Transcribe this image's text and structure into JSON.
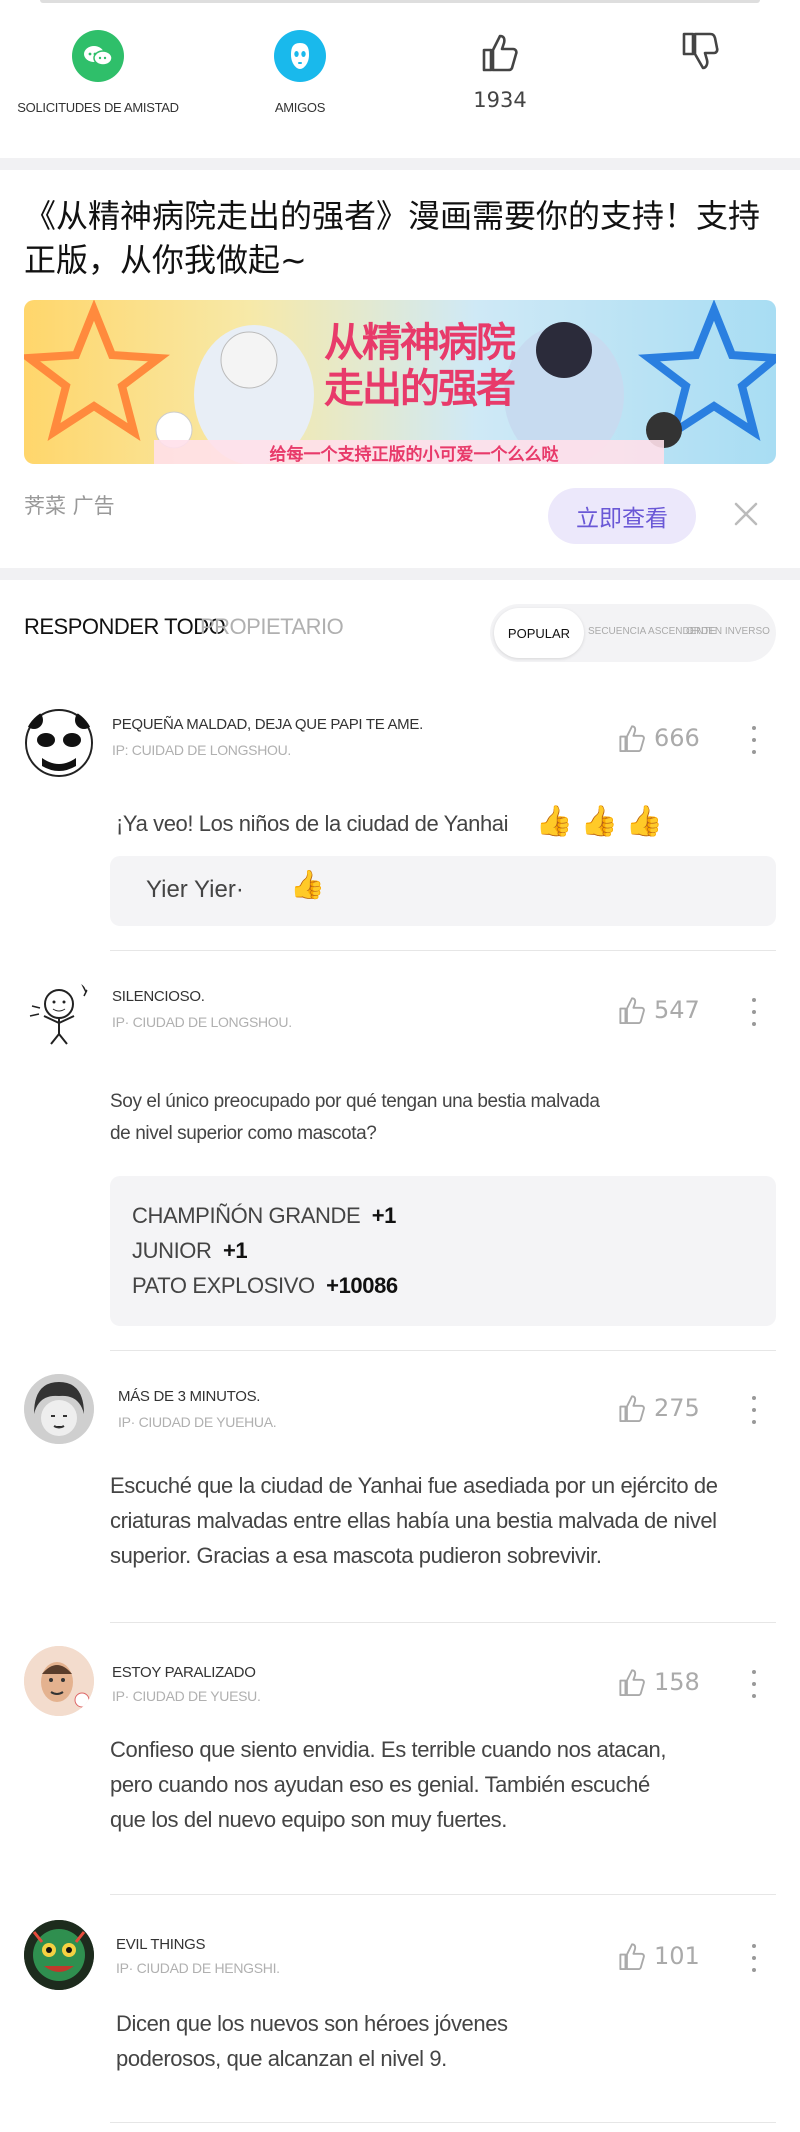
{
  "actions": {
    "friend_requests": "SOLICITUDES DE AMISTAD",
    "friends": "AMIGOS",
    "like_count": "1934"
  },
  "ad": {
    "title": "《从精神病院走出的强者》漫画需要你的支持！支持正版，从你我做起~",
    "source": "荠菜  广告",
    "button": "立即查看",
    "banner_text_main": "从精神病院走出的强者",
    "banner_text_sub": "给每一个支持正版的小可爱一个么么哒"
  },
  "tabs": {
    "all": "RESPONDER TODO",
    "owner": "PROPIETARIO"
  },
  "sort": {
    "popular": "POPULAR",
    "ascending": "SECUENCIA ASCENDENTE",
    "reverse": "ORDEN INVERSO"
  },
  "comments": [
    {
      "name": "PEQUEÑA MALDAD, DEJA QUE PAPI TE AME.",
      "ip": "IP: CUIDAD DE LONGSHOU.",
      "likes": "666",
      "text": "¡Ya veo! Los niños de la ciudad de Yanhai",
      "reply": "Yier Yier·"
    },
    {
      "name": "SILENCIOSO.",
      "ip": "IP· CIUDAD DE LONGSHOU.",
      "likes": "547",
      "text_line1": "Soy el único preocupado por qué tengan una bestia malvada",
      "text_line2": "de nivel superior como mascota?",
      "replies": [
        {
          "name": "CHAMPIÑÓN GRANDE",
          "value": "+1"
        },
        {
          "name": "JUNIOR",
          "value": "+1"
        },
        {
          "name": "PATO EXPLOSIVO",
          "value": "+10086"
        }
      ]
    },
    {
      "name": "MÁS DE 3 MINUTOS.",
      "ip": "IP· CIUDAD DE YUEHUA.",
      "likes": "275",
      "text_line1": "Escuché que la ciudad de Yanhai fue asediada por un ejército de",
      "text_line2": "criaturas malvadas entre ellas había una bestia malvada de nivel",
      "text_line3": "superior. Gracias a esa mascota pudieron sobrevivir."
    },
    {
      "name": "ESTOY PARALIZADO",
      "ip": "IP· CIUDAD DE YUESU.",
      "likes": "158",
      "text_line1": "Confieso que siento envidia. Es terrible cuando nos atacan,",
      "text_line2": "pero cuando nos ayudan eso es genial. También escuché",
      "text_line3": "que los del nuevo equipo son muy fuertes."
    },
    {
      "name": "EVIL THINGS",
      "ip": "IP· CIUDAD DE HENGSHI.",
      "likes": "101",
      "text_line1": "Dicen que los nuevos son héroes jóvenes",
      "text_line2": "poderosos, que alcanzan el nivel 9."
    }
  ]
}
